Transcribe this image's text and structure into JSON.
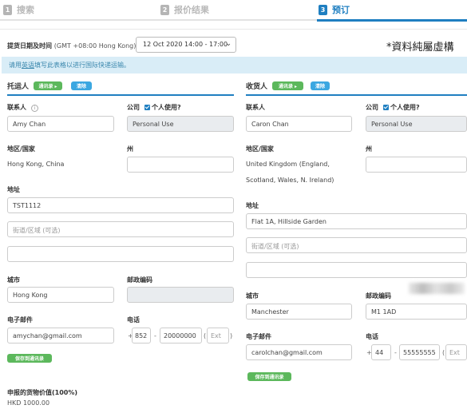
{
  "steps": [
    {
      "num": "1",
      "label": "搜索"
    },
    {
      "num": "2",
      "label": "报价结果"
    },
    {
      "num": "3",
      "label": "预订"
    }
  ],
  "pickup": {
    "label": "提货日期及时间",
    "timezone": "(GMT +08:00 Hong Kong)",
    "value": "12 Oct 2020 14:00 - 17:00"
  },
  "watermark": "*資料純屬虛構",
  "notice": {
    "pre": "请用",
    "em": "英语",
    "post": "填写此表格以进行国际快递运输。"
  },
  "shipper": {
    "title": "托运人",
    "address_book": "通讯录 ▸",
    "clear": "清除",
    "contact_label": "联系人",
    "contact_value": "Amy Chan",
    "company_label": "公司",
    "personal_use_label": "个人使用?",
    "company_value": "Personal Use",
    "region_label": "地区/国家",
    "region_value": "Hong Kong, China",
    "state_label": "州",
    "address_label": "地址",
    "address1": "TST1112",
    "address2_placeholder": "街道/区域 (可选)",
    "city_label": "城市",
    "city_value": "Hong Kong",
    "postcode_label": "邮政编码",
    "email_label": "电子邮件",
    "email_value": "amychan@gmail.com",
    "phone_label": "电话",
    "phone_plus": "+",
    "phone_cc": "852",
    "phone_dash": "-",
    "phone_number": "20000000",
    "phone_ext": "Ext",
    "save_label": "保存到通讯录",
    "declared_label": "申报的货物价值(100%)",
    "declared_value": "HKD 1000.00"
  },
  "receiver": {
    "title": "收货人",
    "address_book": "通讯录 ▸",
    "clear": "清除",
    "contact_label": "联系人",
    "contact_value": "Caron Chan",
    "company_label": "公司",
    "personal_use_label": "个人使用?",
    "company_value": "Personal Use",
    "region_label": "地区/国家",
    "region_line1": "United Kingdom (England,",
    "region_line2": "Scotland, Wales, N. Ireland)",
    "state_label": "州",
    "address_label": "地址",
    "address1": "Flat 1A, Hillside Garden",
    "address2_placeholder": "街道/区域 (可选)",
    "city_label": "城市",
    "city_value": "Manchester",
    "postcode_label": "邮政编码",
    "postcode_value": "M1 1AD",
    "email_label": "电子邮件",
    "email_value": "carolchan@gmail.com",
    "phone_label": "电话",
    "phone_plus": "+",
    "phone_cc": "44",
    "phone_dash": "-",
    "phone_number": "55555555",
    "phone_ext": "Ext",
    "save_label": "保存到通讯录"
  },
  "colors": {
    "accent": "#1f7fc1",
    "green": "#5cb85c",
    "notice_bg": "#d9edf7"
  }
}
